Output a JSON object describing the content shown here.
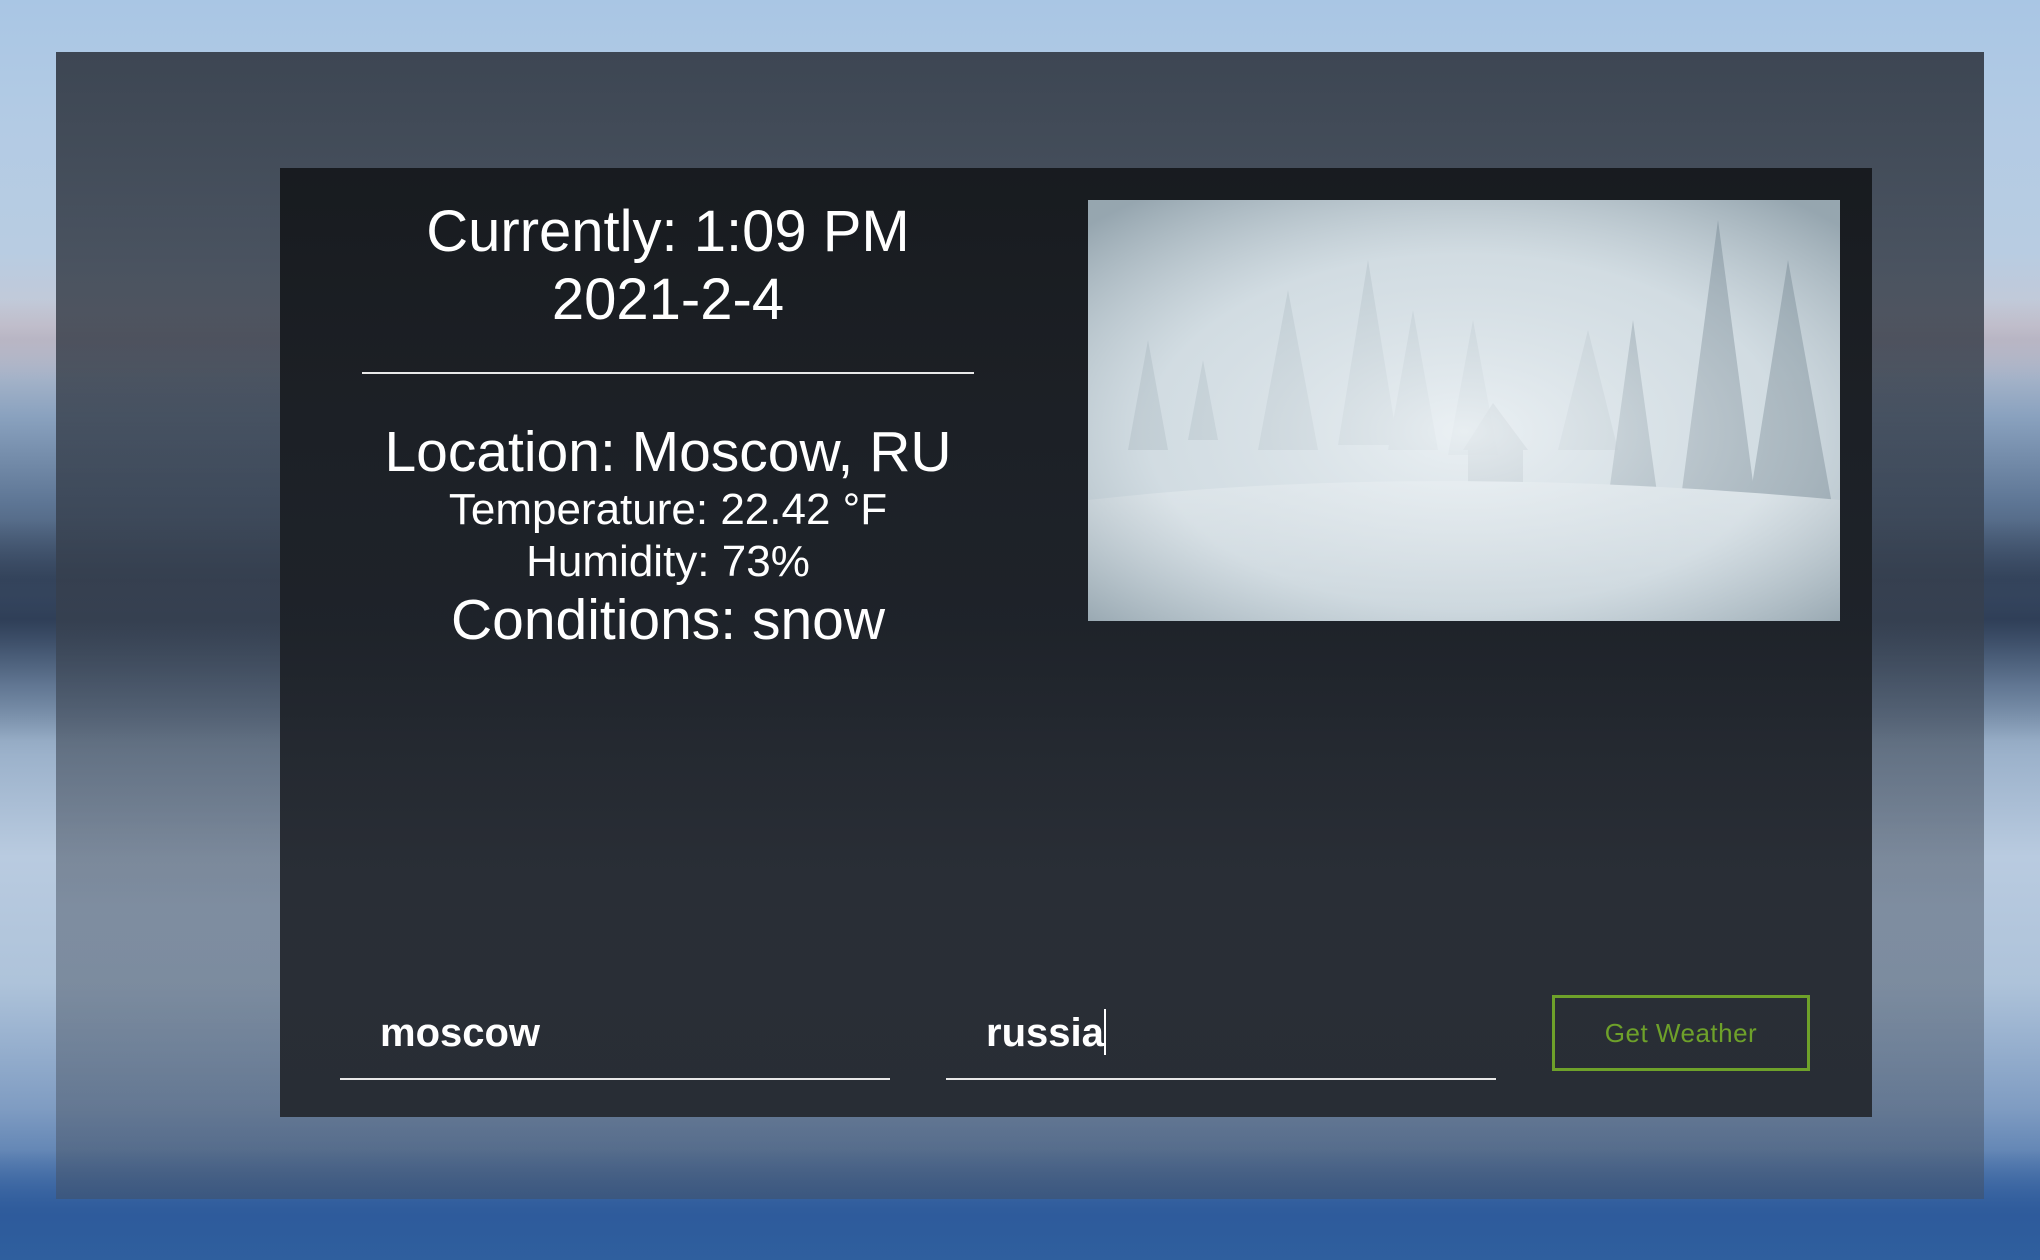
{
  "weather": {
    "time_line": "Currently: 1:09 PM",
    "date_line": "2021-2-4",
    "location_line": "Location: Moscow, RU",
    "temperature_line": "Temperature: 22.42 °F",
    "humidity_line": "Humidity: 73%",
    "conditions_line": "Conditions: snow"
  },
  "photo": {
    "subject": "snowstorm-forest-cabin"
  },
  "form": {
    "city_value": "moscow",
    "country_value": "russia",
    "submit_label": "Get Weather"
  },
  "colors": {
    "button_accent": "#6ea12a",
    "card_background": "#1c2026",
    "text": "#ffffff"
  }
}
